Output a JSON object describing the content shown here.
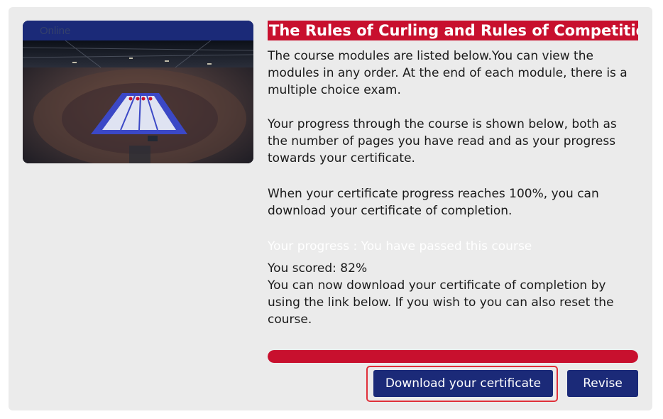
{
  "thumbnail": {
    "badge": "Online"
  },
  "course": {
    "title": "The Rules of Curling and Rules of Competition",
    "intro": "The course modules are listed below.You can view the modules in any order. At the end of each module, there is a multiple choice exam.",
    "progress_info": "Your progress through the course is shown below, both as the number of pages you have read and as your progress towards your certificate.",
    "certificate_info": "When your certificate progress reaches 100%, you can download your certificate of completion."
  },
  "result": {
    "progress_label": "Your progress : You have passed this course",
    "score": "You scored: 82%",
    "message": "You can now download your certificate of completion by using the link below. If you wish to you can also reset the course.",
    "progress_percent": 100
  },
  "buttons": {
    "download": "Download your certificate",
    "revise": "Revise"
  },
  "colors": {
    "accent_red": "#c8102e",
    "navy": "#1b2a78",
    "card_bg": "#ebebeb"
  }
}
